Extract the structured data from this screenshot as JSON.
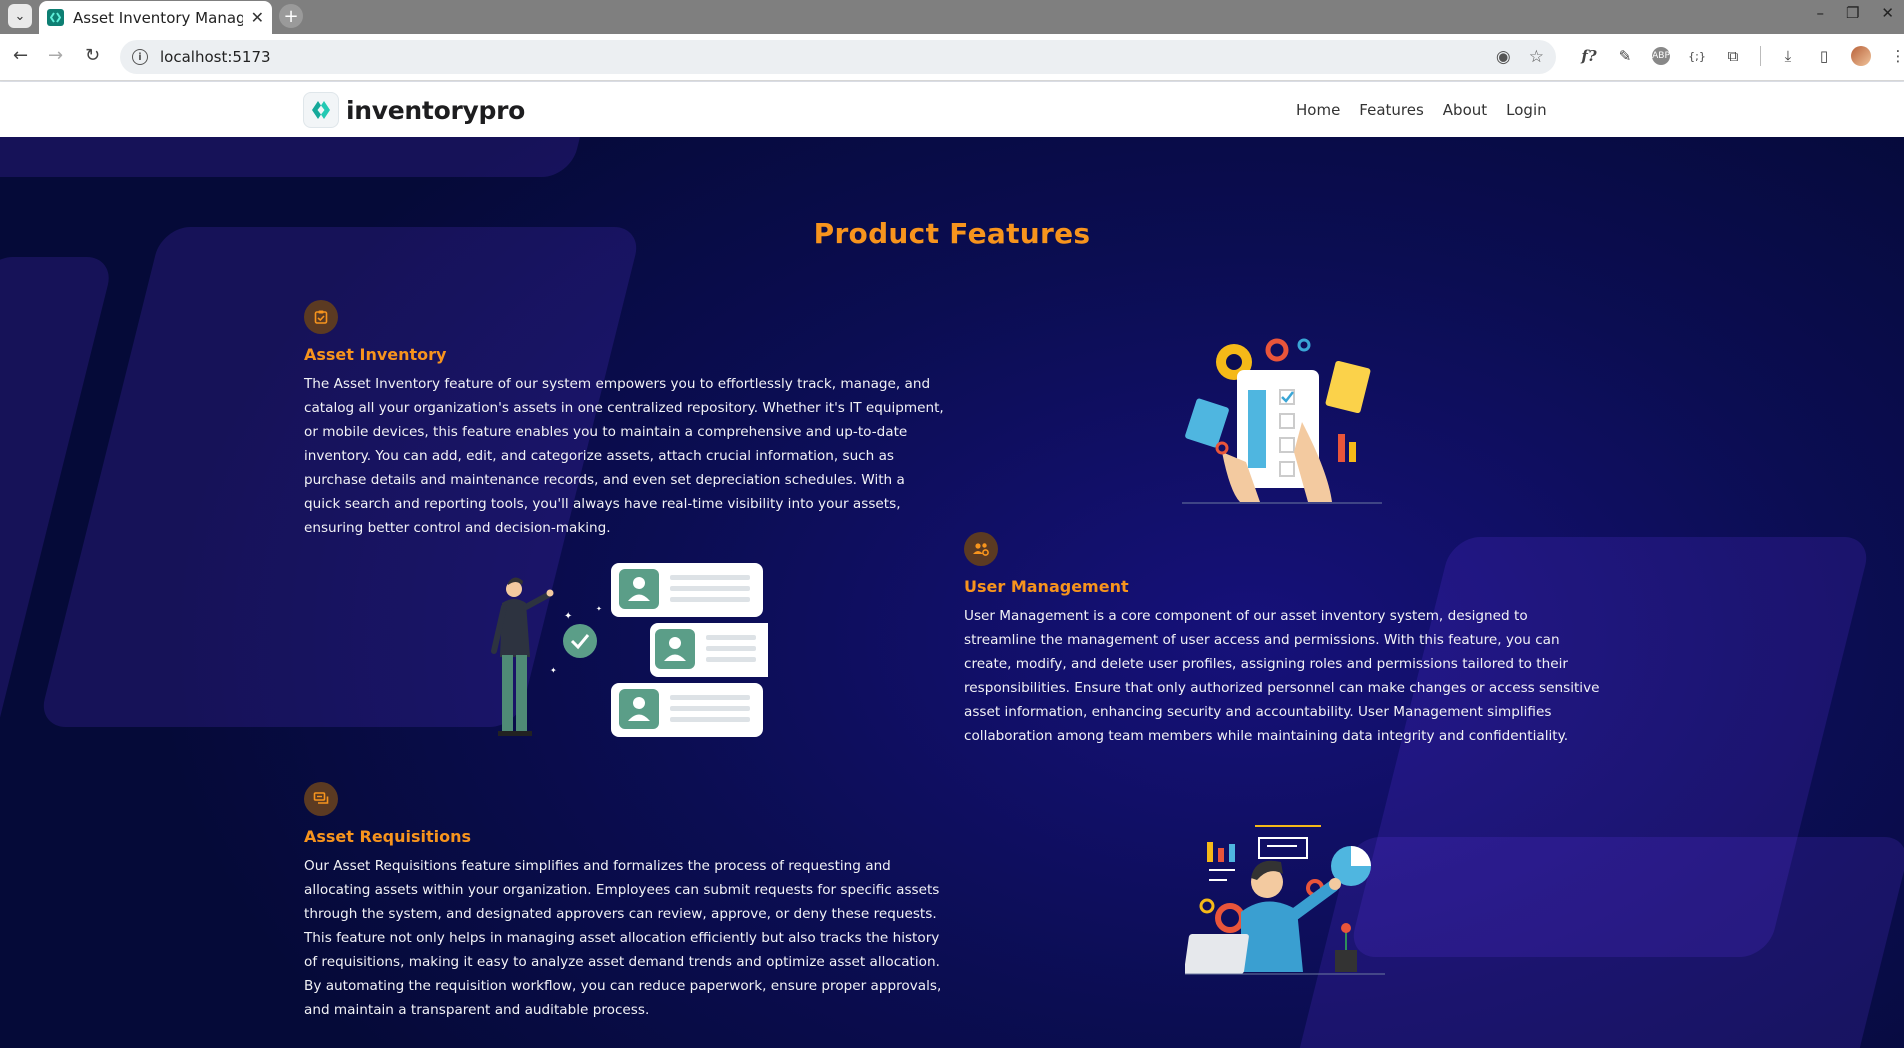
{
  "browser": {
    "tab_title": "Asset Inventory Manage",
    "url": "localhost:5173"
  },
  "navbar": {
    "brand": "inventorypro",
    "links": [
      "Home",
      "Features",
      "About",
      "Login"
    ]
  },
  "main": {
    "title": "Product Features",
    "features": [
      {
        "icon": "clipboard-check-icon",
        "title": "Asset Inventory",
        "description": "The Asset Inventory feature of our system empowers you to effortlessly track, manage, and catalog all your organization's assets in one centralized repository. Whether it's IT equipment, or mobile devices, this feature enables you to maintain a comprehensive and up-to-date inventory. You can add, edit, and categorize assets, attach crucial information, such as purchase details and maintenance records, and even set depreciation schedules. With a quick search and reporting tools, you'll always have real-time visibility into your assets, ensuring better control and decision-making."
      },
      {
        "icon": "users-gear-icon",
        "title": "User Management",
        "description": "User Management is a core component of our asset inventory system, designed to streamline the management of user access and permissions. With this feature, you can create, modify, and delete user profiles, assigning roles and permissions tailored to their responsibilities. Ensure that only authorized personnel can make changes or access sensitive asset information, enhancing security and accountability. User Management simplifies collaboration among team members while maintaining data integrity and confidentiality."
      },
      {
        "icon": "chat-bubbles-icon",
        "title": "Asset Requisitions",
        "description": "Our Asset Requisitions feature simplifies and formalizes the process of requesting and allocating assets within your organization. Employees can submit requests for specific assets through the system, and designated approvers can review, approve, or deny these requests. This feature not only helps in managing asset allocation efficiently but also tracks the history of requisitions, making it easy to analyze asset demand trends and optimize asset allocation. By automating the requisition workflow, you can reduce paperwork, ensure proper approvals, and maintain a transparent and auditable process."
      }
    ]
  },
  "colors": {
    "accent": "#f7941d",
    "background": "#0b0d52",
    "brand_teal": "#1ab5a3"
  }
}
